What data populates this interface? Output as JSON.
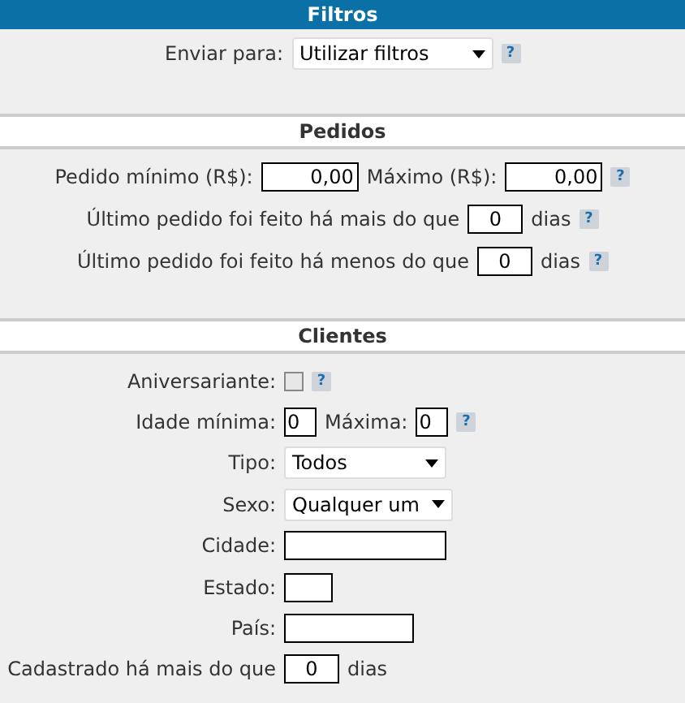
{
  "header": {
    "title": "Filtros"
  },
  "sections": [
    {
      "kind": "centered",
      "rows": [
        {
          "label": "Enviar para:",
          "controls": [
            {
              "kind": "dropdown",
              "value": "Utilizar filtros"
            },
            {
              "kind": "help",
              "text": "?"
            }
          ]
        }
      ]
    },
    {
      "kind": "centered",
      "title": "Pedidos",
      "rows": [
        {
          "label": "Pedido mínimo (R$):",
          "controls": [
            {
              "kind": "money",
              "value": "0,00"
            },
            {
              "kind": "label",
              "text": "Máximo (R$):"
            },
            {
              "kind": "money",
              "value": "0,00"
            },
            {
              "kind": "help",
              "text": "?"
            }
          ]
        },
        {
          "label": "Último pedido foi feito há mais do que",
          "controls": [
            {
              "kind": "days",
              "value": "0"
            },
            {
              "kind": "label",
              "text": "dias"
            },
            {
              "kind": "help",
              "text": "?"
            }
          ]
        },
        {
          "label": "Último pedido foi feito há menos do que",
          "controls": [
            {
              "kind": "days",
              "value": "0"
            },
            {
              "kind": "label",
              "text": "dias"
            },
            {
              "kind": "help",
              "text": "?"
            }
          ]
        }
      ]
    },
    {
      "kind": "form",
      "title": "Clientes",
      "rows": [
        {
          "label": "Aniversariante:",
          "controls": [
            {
              "kind": "checkbox",
              "checked": false
            },
            {
              "kind": "help",
              "text": "?"
            }
          ]
        },
        {
          "label": "Idade mínima:",
          "controls": [
            {
              "kind": "age",
              "value": "0"
            },
            {
              "kind": "label",
              "text": "Máxima:"
            },
            {
              "kind": "age",
              "value": "0"
            },
            {
              "kind": "help",
              "text": "?"
            }
          ]
        },
        {
          "label": "Tipo:",
          "controls": [
            {
              "kind": "choice",
              "value": "Todos"
            }
          ]
        },
        {
          "label": "Sexo:",
          "controls": [
            {
              "kind": "choice",
              "value": "Qualquer um"
            }
          ]
        },
        {
          "label": "Cidade:",
          "controls": [
            {
              "kind": "city"
            }
          ]
        },
        {
          "label": "Estado:",
          "controls": [
            {
              "kind": "state"
            }
          ]
        },
        {
          "label": "País:",
          "controls": [
            {
              "kind": "country"
            }
          ]
        },
        {
          "label": "Cadastrado há mais do que",
          "controls": [
            {
              "kind": "days",
              "value": "0"
            },
            {
              "kind": "label",
              "text": "dias"
            }
          ]
        }
      ]
    }
  ]
}
